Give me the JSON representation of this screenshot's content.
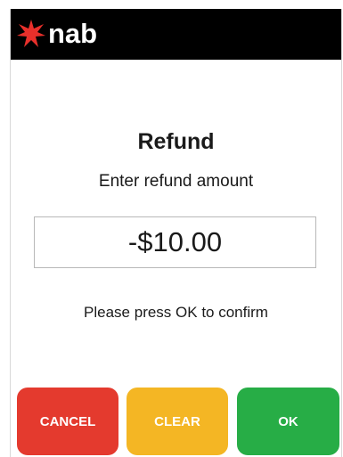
{
  "header": {
    "logo_text": "nab",
    "logo_icon": "nab-star-icon",
    "background_color": "#000000",
    "logo_color": "#e8302b"
  },
  "main": {
    "title": "Refund",
    "subtitle": "Enter refund amount",
    "amount": "-$10.00",
    "confirm_text": "Please press OK to confirm"
  },
  "buttons": {
    "cancel_label": "CANCEL",
    "clear_label": "CLEAR",
    "ok_label": "OK",
    "cancel_color": "#e43a2e",
    "clear_color": "#f4b624",
    "ok_color": "#27ad46"
  }
}
